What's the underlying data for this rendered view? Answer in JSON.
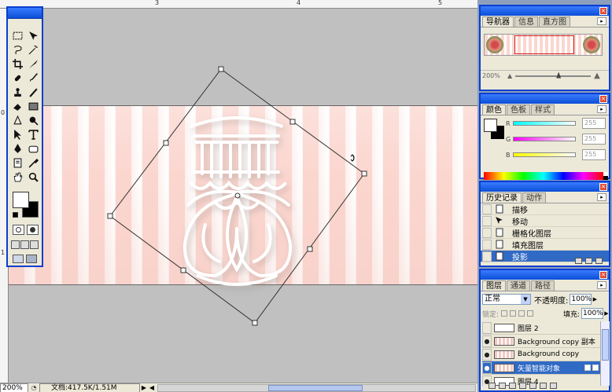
{
  "ruler": {
    "top_labels": [
      "3",
      "4",
      "5"
    ],
    "left_labels": [
      "0",
      "1"
    ]
  },
  "status": {
    "zoom": "200%",
    "doc_info": "文档:417.5K/1.51M"
  },
  "navigator": {
    "tabs": [
      "导航器",
      "信息",
      "直方图"
    ],
    "zoom": "200%"
  },
  "color": {
    "tabs": [
      "颜色",
      "色板",
      "样式"
    ],
    "channels": [
      {
        "letter": "R",
        "value": "255",
        "gradient": "linear-gradient(90deg,#00ffff,#ffffff)"
      },
      {
        "letter": "G",
        "value": "255",
        "gradient": "linear-gradient(90deg,#ff00ff,#ffffff)"
      },
      {
        "letter": "B",
        "value": "255",
        "gradient": "linear-gradient(90deg,#ffff00,#ffffff)"
      }
    ]
  },
  "history": {
    "tabs": [
      "历史记录",
      "动作"
    ],
    "items": [
      {
        "label": "描移",
        "icon": "document-icon",
        "selected": false
      },
      {
        "label": "移动",
        "icon": "move-tool-icon",
        "selected": false
      },
      {
        "label": "栅格化图层",
        "icon": "document-icon",
        "selected": false
      },
      {
        "label": "填充图层",
        "icon": "document-icon",
        "selected": false
      },
      {
        "label": "投影",
        "icon": "document-icon",
        "selected": true
      }
    ]
  },
  "layers": {
    "tabs": [
      "图层",
      "通道",
      "路径"
    ],
    "blend_mode": "正常",
    "opacity_label": "不透明度:",
    "opacity": "100%",
    "lock_label": "锁定:",
    "fill_label": "填充:",
    "fill": "100%",
    "items": [
      {
        "name": "图层 2",
        "visible": false,
        "selected": false,
        "thumb": "white"
      },
      {
        "name": "Background copy 副本",
        "visible": true,
        "selected": false,
        "thumb": "stripes"
      },
      {
        "name": "Background copy",
        "visible": true,
        "selected": false,
        "thumb": "stripes"
      },
      {
        "name": "矢量智能对象",
        "visible": true,
        "selected": true,
        "thumb": "stripes"
      },
      {
        "name": "图层 4",
        "visible": true,
        "selected": false,
        "thumb": "white"
      }
    ]
  },
  "colors": {
    "panel_border": "#0a3ecf",
    "selection": "#316ac5",
    "stripe_pink": "#fbd6cf"
  }
}
